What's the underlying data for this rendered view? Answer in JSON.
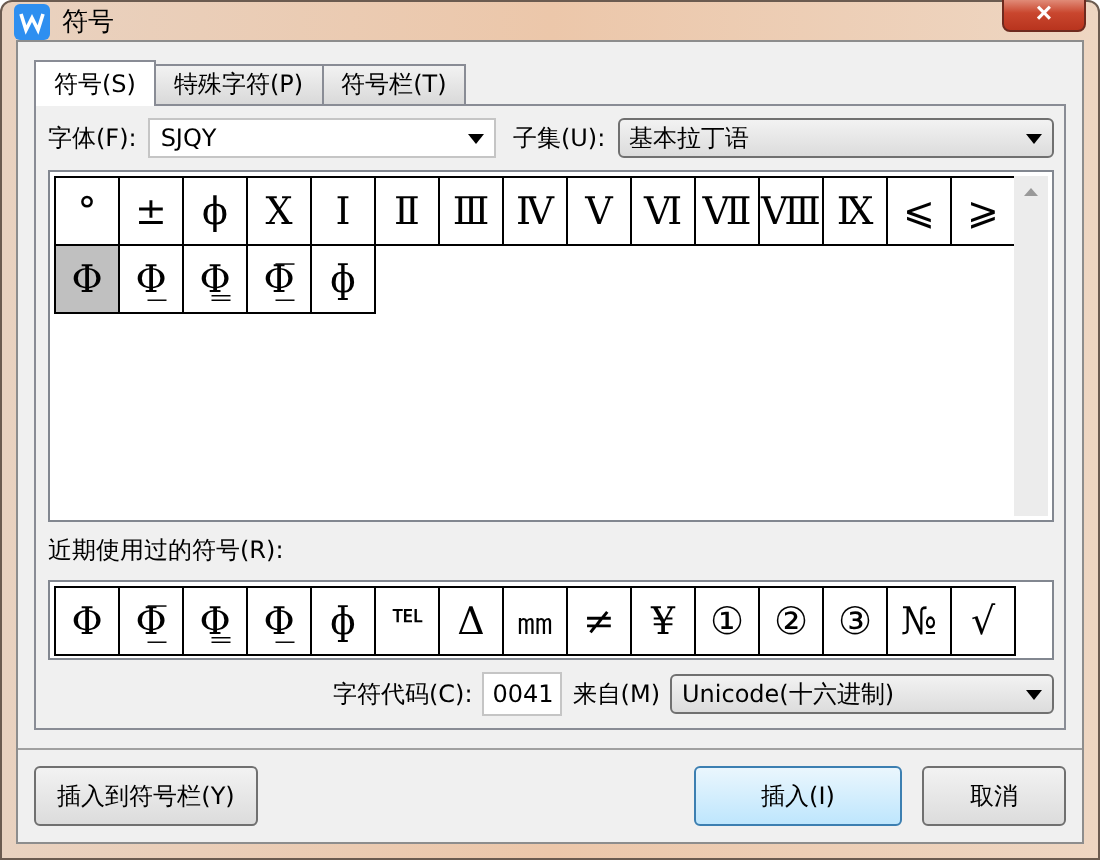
{
  "window": {
    "title": "符号",
    "close": "×"
  },
  "tabs": [
    {
      "label": "符号(S)",
      "selected": true
    },
    {
      "label": "特殊字符(P)",
      "selected": false
    },
    {
      "label": "符号栏(T)",
      "selected": false
    }
  ],
  "font": {
    "label": "字体(F):",
    "value": "SJQY"
  },
  "subset": {
    "label": "子集(U):",
    "value": "基本拉丁语"
  },
  "symbols": [
    {
      "char": "°",
      "selected": false
    },
    {
      "char": "±",
      "selected": false
    },
    {
      "char": "ϕ",
      "selected": false
    },
    {
      "char": "Ⅹ",
      "selected": false
    },
    {
      "char": "Ⅰ",
      "selected": false
    },
    {
      "char": "Ⅱ",
      "selected": false
    },
    {
      "char": "Ⅲ",
      "selected": false
    },
    {
      "char": "Ⅳ",
      "selected": false
    },
    {
      "char": "Ⅴ",
      "selected": false
    },
    {
      "char": "Ⅵ",
      "selected": false
    },
    {
      "char": "Ⅶ",
      "selected": false
    },
    {
      "char": "Ⅷ",
      "selected": false
    },
    {
      "char": "Ⅸ",
      "selected": false
    },
    {
      "char": "⩽",
      "selected": false
    },
    {
      "char": "⩾",
      "selected": false
    },
    {
      "char": "Φ",
      "selected": true
    },
    {
      "char": "Φ̲",
      "selected": false
    },
    {
      "char": "Φ̳",
      "selected": false
    },
    {
      "char": "Φ̲̅",
      "selected": false
    },
    {
      "char": "ɸ",
      "selected": false
    }
  ],
  "recent": {
    "label": "近期使用过的符号(R):",
    "symbols": [
      "Φ",
      "Φ̲̅",
      "Φ̳",
      "Φ̲",
      "ɸ",
      "℡",
      "Δ",
      "㎜",
      "≠",
      "¥",
      "①",
      "②",
      "③",
      "№",
      "√"
    ]
  },
  "code": {
    "label": "字符代码(C):",
    "value": "0041",
    "from_label": "来自(M)",
    "from_value": "Unicode(十六进制)"
  },
  "buttons": {
    "add_to_bar": "插入到符号栏(Y)",
    "insert": "插入(I)",
    "cancel": "取消"
  }
}
